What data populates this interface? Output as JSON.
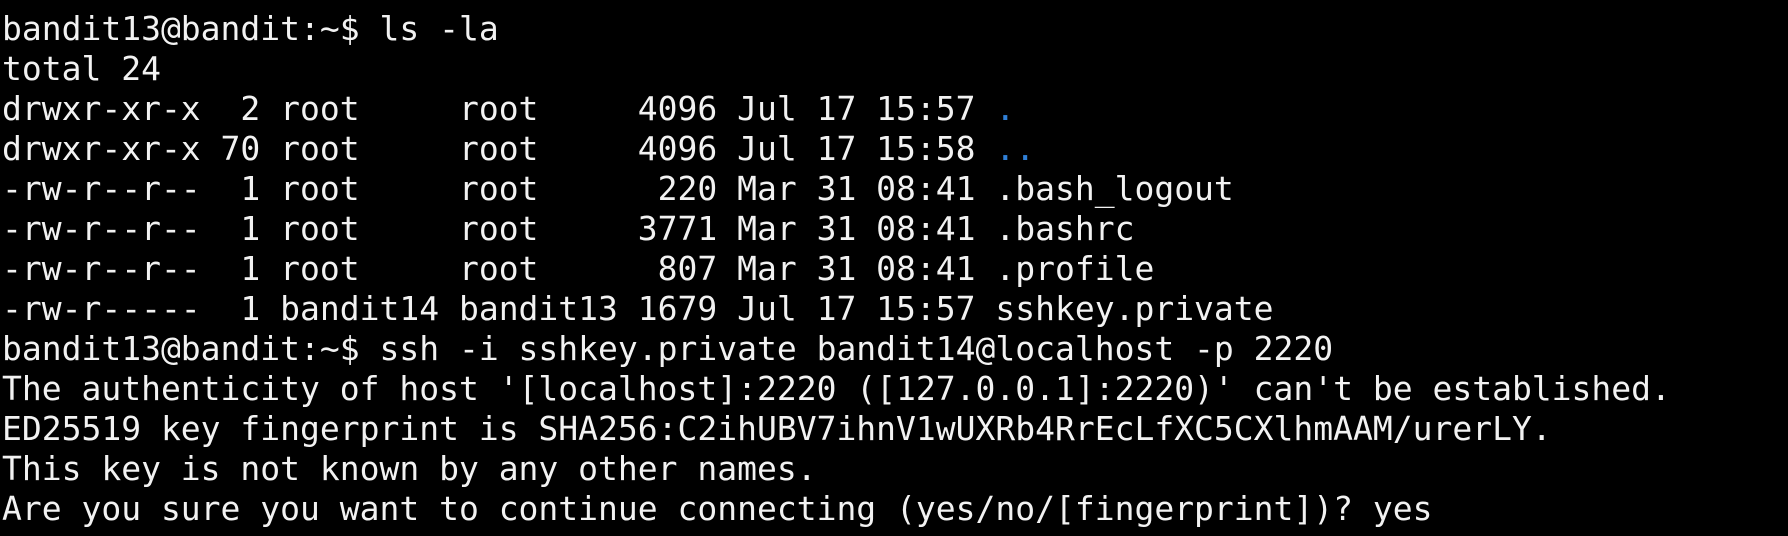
{
  "terminal": {
    "colors": {
      "background": "#000000",
      "foreground": "#f2f2f2",
      "directory": "#2f7fd6"
    },
    "lines": [
      {
        "segments": [
          {
            "text": "bandit13@bandit:~$ ls -la"
          }
        ]
      },
      {
        "segments": [
          {
            "text": "total 24"
          }
        ]
      },
      {
        "segments": [
          {
            "text": "drwxr-xr-x  2 root     root     4096 Jul 17 15:57 "
          },
          {
            "text": ".",
            "color": "directory"
          }
        ]
      },
      {
        "segments": [
          {
            "text": "drwxr-xr-x 70 root     root     4096 Jul 17 15:58 "
          },
          {
            "text": "..",
            "color": "directory"
          }
        ]
      },
      {
        "segments": [
          {
            "text": "-rw-r--r--  1 root     root      220 Mar 31 08:41 .bash_logout"
          }
        ]
      },
      {
        "segments": [
          {
            "text": "-rw-r--r--  1 root     root     3771 Mar 31 08:41 .bashrc"
          }
        ]
      },
      {
        "segments": [
          {
            "text": "-rw-r--r--  1 root     root      807 Mar 31 08:41 .profile"
          }
        ]
      },
      {
        "segments": [
          {
            "text": "-rw-r-----  1 bandit14 bandit13 1679 Jul 17 15:57 sshkey.private"
          }
        ]
      },
      {
        "segments": [
          {
            "text": "bandit13@bandit:~$ ssh -i sshkey.private bandit14@localhost -p 2220"
          }
        ]
      },
      {
        "segments": [
          {
            "text": "The authenticity of host '[localhost]:2220 ([127.0.0.1]:2220)' can't be established."
          }
        ]
      },
      {
        "segments": [
          {
            "text": "ED25519 key fingerprint is SHA256:C2ihUBV7ihnV1wUXRb4RrEcLfXC5CXlhmAAM/urerLY."
          }
        ]
      },
      {
        "segments": [
          {
            "text": "This key is not known by any other names."
          }
        ]
      },
      {
        "segments": [
          {
            "text": "Are you sure you want to continue connecting (yes/no/[fingerprint])? yes"
          }
        ]
      }
    ]
  }
}
